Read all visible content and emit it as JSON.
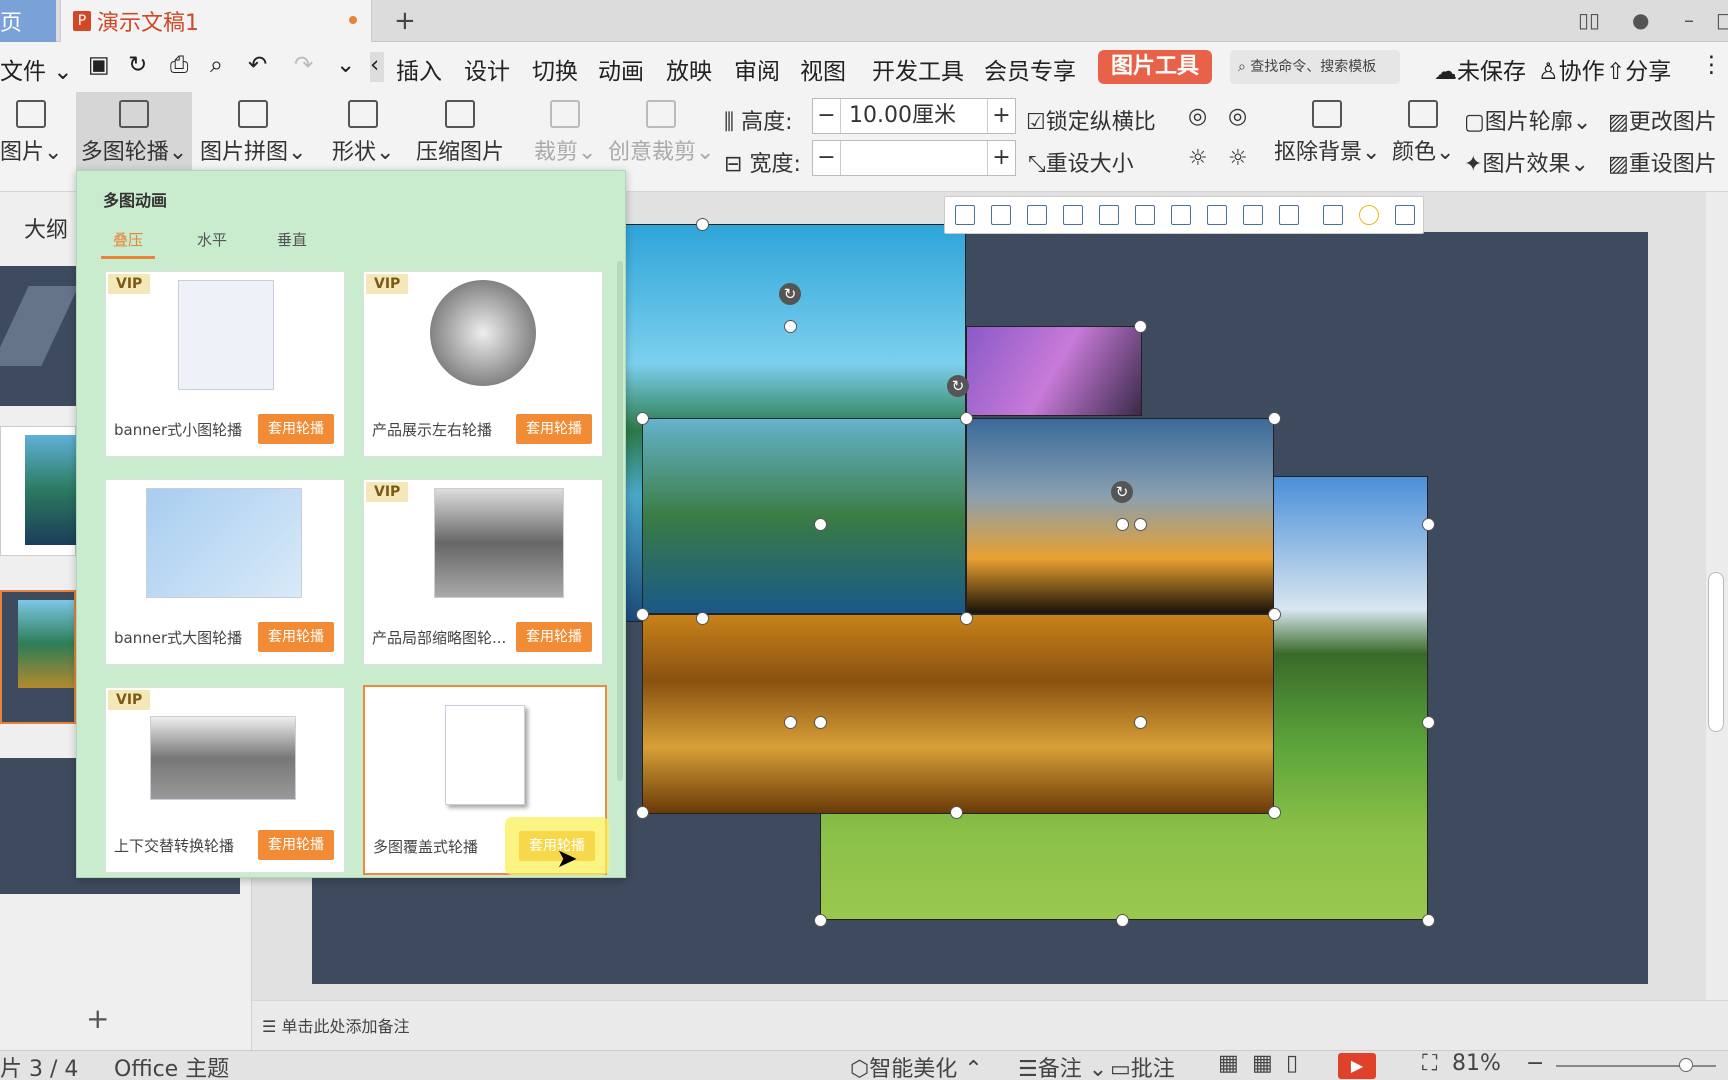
{
  "tabs": {
    "home": "页",
    "doc": "演示文稿1",
    "new": "+"
  },
  "menu": {
    "file": "文件",
    "items": [
      "插入",
      "设计",
      "切换",
      "动画",
      "放映",
      "审阅",
      "视图",
      "开发工具",
      "会员专享"
    ],
    "active_tool": "图片工具",
    "search": "查找命令、搜索模板",
    "unsaved": "未保存",
    "collab": "协作",
    "share": "分享"
  },
  "ribbon": {
    "insert_pic": "图片",
    "multi_carousel": "多图轮播",
    "collage": "图片拼图",
    "shape": "形状",
    "compress": "压缩图片",
    "crop": "裁剪",
    "creative_crop": "创意裁剪",
    "height_label": "高度:",
    "height_value": "10.00厘米",
    "width_label": "宽度:",
    "width_value": "",
    "lock_ratio": "锁定纵横比",
    "reset_size": "重设大小",
    "remove_bg": "抠除背景",
    "color": "颜色",
    "outline": "图片轮廓",
    "effects": "图片效果",
    "change_pic": "更改图片",
    "reset_pic": "重设图片",
    "minus": "−",
    "plus": "+"
  },
  "left_pane": {
    "outline_tab": "大纲",
    "add": "+"
  },
  "popup": {
    "title": "多图动画",
    "tabs": [
      "叠压",
      "水平",
      "垂直"
    ],
    "cards": [
      {
        "name": "banner式小图轮播",
        "vip": "VIP",
        "apply": "套用轮播"
      },
      {
        "name": "产品展示左右轮播",
        "vip": "VIP",
        "apply": "套用轮播"
      },
      {
        "name": "banner式大图轮播",
        "vip": "",
        "apply": "套用轮播"
      },
      {
        "name": "产品局部缩略图轮...",
        "vip": "VIP",
        "apply": "套用轮播"
      },
      {
        "name": "上下交替转换轮播",
        "vip": "VIP",
        "apply": "套用轮播"
      },
      {
        "name": "多图覆盖式轮播",
        "vip": "",
        "apply": "套用轮播"
      }
    ]
  },
  "notes": {
    "placeholder": "单击此处添加备注"
  },
  "status": {
    "slide": "片 3 / 4",
    "theme": "Office 主题",
    "beautify": "智能美化",
    "notes": "备注",
    "comment": "批注",
    "zoom": "81%",
    "zoom_fraction": 0.81
  },
  "colors": {
    "accent": "#e8624a",
    "slide_bg": "#3e4a5e",
    "popup_bg": "#c8eccd",
    "apply_btn": "#f28b35"
  }
}
